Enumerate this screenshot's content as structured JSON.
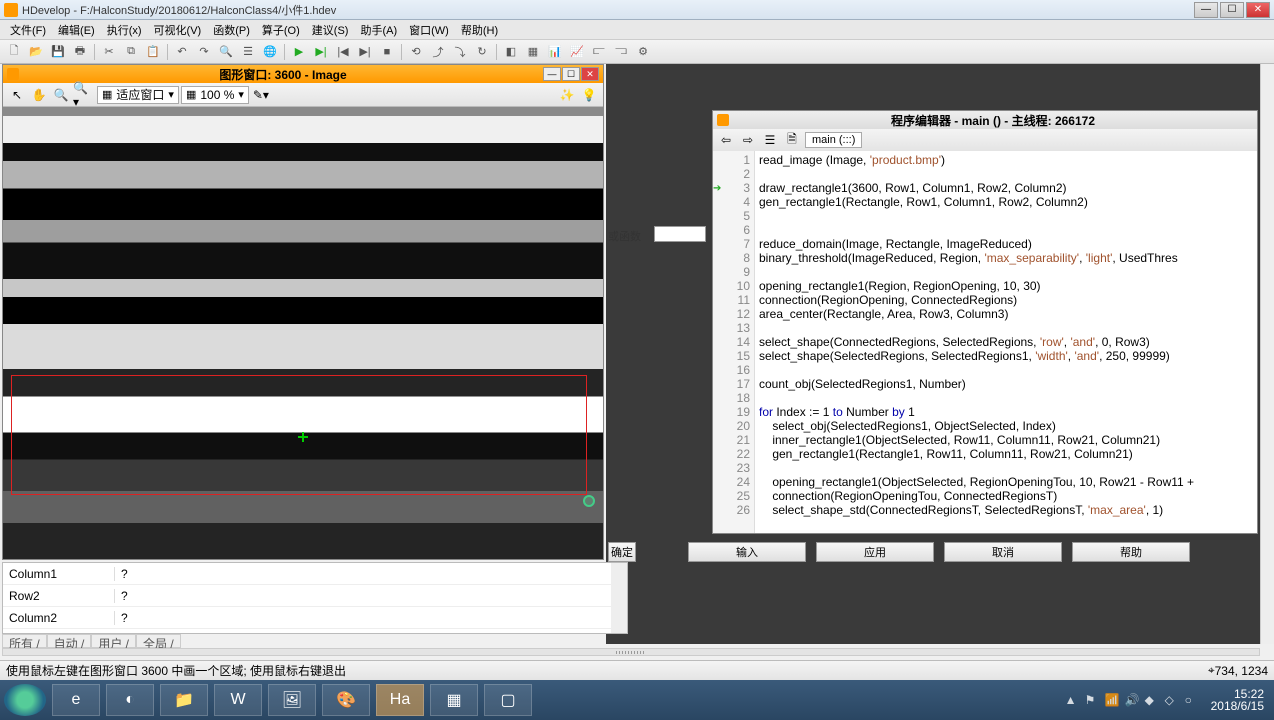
{
  "window": {
    "title": "HDevelop - F:/HalconStudy/20180612/HalconClass4/小件1.hdev"
  },
  "menu": [
    "文件(F)",
    "编辑(E)",
    "执行(x)",
    "可视化(V)",
    "函数(P)",
    "算子(O)",
    "建议(S)",
    "助手(A)",
    "窗口(W)",
    "帮助(H)"
  ],
  "graphics": {
    "title": "图形窗口: 3600 - Image",
    "fit_label": "适应窗口",
    "zoom_label": "100 %"
  },
  "editor": {
    "title": "程序编辑器 - main () - 主线程: 266172",
    "function": "main (:::)"
  },
  "code": [
    {
      "n": 1,
      "t": "read_image (Image, 'product.bmp')"
    },
    {
      "n": 2,
      "t": ""
    },
    {
      "n": 3,
      "t": "draw_rectangle1(3600, Row1, Column1, Row2, Column2)",
      "arrow": true
    },
    {
      "n": 4,
      "t": "gen_rectangle1(Rectangle, Row1, Column1, Row2, Column2)"
    },
    {
      "n": 5,
      "t": ""
    },
    {
      "n": 6,
      "t": ""
    },
    {
      "n": 7,
      "t": "reduce_domain(Image, Rectangle, ImageReduced)"
    },
    {
      "n": 8,
      "t": "binary_threshold(ImageReduced, Region, 'max_separability', 'light', UsedThres"
    },
    {
      "n": 9,
      "t": ""
    },
    {
      "n": 10,
      "t": "opening_rectangle1(Region, RegionOpening, 10, 30)"
    },
    {
      "n": 11,
      "t": "connection(RegionOpening, ConnectedRegions)"
    },
    {
      "n": 12,
      "t": "area_center(Rectangle, Area, Row3, Column3)"
    },
    {
      "n": 13,
      "t": ""
    },
    {
      "n": 14,
      "t": "select_shape(ConnectedRegions, SelectedRegions, 'row', 'and', 0, Row3)"
    },
    {
      "n": 15,
      "t": "select_shape(SelectedRegions, SelectedRegions1, 'width', 'and', 250, 99999)"
    },
    {
      "n": 16,
      "t": ""
    },
    {
      "n": 17,
      "t": "count_obj(SelectedRegions1, Number)"
    },
    {
      "n": 18,
      "t": ""
    },
    {
      "n": 19,
      "t": "for Index := 1 to Number by 1",
      "for": true
    },
    {
      "n": 20,
      "t": "    select_obj(SelectedRegions1, ObjectSelected, Index)"
    },
    {
      "n": 21,
      "t": "    inner_rectangle1(ObjectSelected, Row11, Column11, Row21, Column21)"
    },
    {
      "n": 22,
      "t": "    gen_rectangle1(Rectangle1, Row11, Column11, Row21, Column21)"
    },
    {
      "n": 23,
      "t": ""
    },
    {
      "n": 24,
      "t": "    opening_rectangle1(ObjectSelected, RegionOpeningTou, 10, Row21 - Row11 +"
    },
    {
      "n": 25,
      "t": "    connection(RegionOpeningTou, ConnectedRegionsT)"
    },
    {
      "n": 26,
      "t": "    select_shape_std(ConnectedRegionsT, SelectedRegionsT, 'max_area', 1)"
    }
  ],
  "mid": {
    "label": "或函数"
  },
  "vars": [
    {
      "name": "Column1",
      "value": "?"
    },
    {
      "name": "Row2",
      "value": "?"
    },
    {
      "name": "Column2",
      "value": "?"
    }
  ],
  "var_tabs": [
    "所有 /",
    "自动 /",
    "用户 /",
    "全局 /"
  ],
  "buttons": {
    "confirm": "确定",
    "insert": "输入",
    "apply": "应用",
    "cancel": "取消",
    "help": "帮助"
  },
  "status": {
    "text": "使用鼠标左键在图形窗口 3600 中画一个区域; 使用鼠标右键退出",
    "coords": "734, 1234"
  },
  "tray": {
    "time": "15:22",
    "date": "2018/6/15"
  }
}
